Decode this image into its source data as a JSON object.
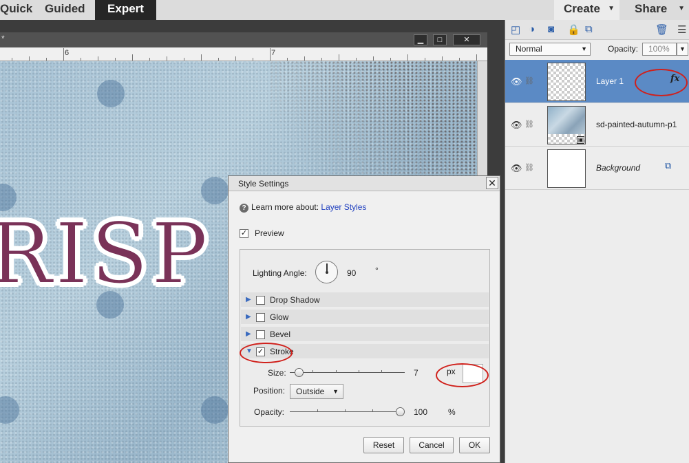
{
  "modes": {
    "quick": "Quick",
    "guided": "Guided",
    "expert": "Expert"
  },
  "actions": {
    "create": "Create",
    "share": "Share"
  },
  "document": {
    "title_fragment": "*",
    "ruler_labels": [
      "6",
      "7"
    ],
    "canvas_text": "RISP .",
    "window_buttons": {
      "minimize": "▁",
      "maximize": "□",
      "close": "✕"
    }
  },
  "layers_panel": {
    "blend_mode": "Normal",
    "opacity_label": "Opacity:",
    "opacity_value": "100%",
    "layers": [
      {
        "name": "Layer 1",
        "selected": true,
        "has_fx": true,
        "fx_label": "fx"
      },
      {
        "name": "sd-painted-autumn-p1",
        "selected": false
      },
      {
        "name": "Background",
        "selected": false,
        "locked": true
      }
    ]
  },
  "dialog": {
    "title": "Style Settings",
    "learn_label": "Learn more about:",
    "learn_link": "Layer Styles",
    "preview_label": "Preview",
    "preview_checked": true,
    "lighting_label": "Lighting Angle:",
    "lighting_value": "90",
    "lighting_unit": "°",
    "sections": [
      {
        "label": "Drop Shadow",
        "checked": false,
        "expanded": false
      },
      {
        "label": "Glow",
        "checked": false,
        "expanded": false
      },
      {
        "label": "Bevel",
        "checked": false,
        "expanded": false
      },
      {
        "label": "Stroke",
        "checked": true,
        "expanded": true
      }
    ],
    "stroke": {
      "size_label": "Size:",
      "size_value": "7",
      "size_unit": "px",
      "position_label": "Position:",
      "position_value": "Outside",
      "opacity_label": "Opacity:",
      "opacity_value": "100",
      "opacity_unit": "%"
    },
    "buttons": {
      "reset": "Reset",
      "cancel": "Cancel",
      "ok": "OK"
    }
  },
  "colors": {
    "selected_layer": "#5b8ac5",
    "stroke_text": "#7a3258",
    "annotation": "#d0201b",
    "link": "#1f3fbf"
  }
}
